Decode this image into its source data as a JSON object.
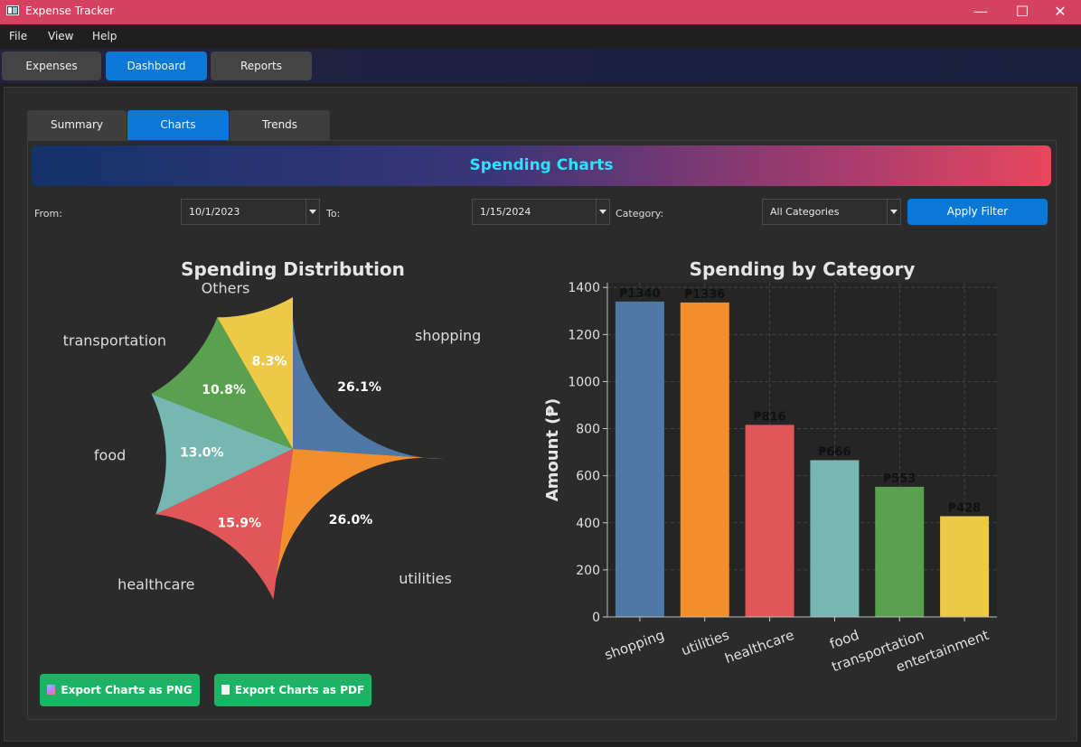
{
  "window": {
    "title": "Expense Tracker",
    "minimize_glyph": "—",
    "maximize_glyph": "☐",
    "close_glyph": "✕"
  },
  "menu": [
    "File",
    "View",
    "Help"
  ],
  "main_tabs": [
    "Expenses",
    "Dashboard",
    "Reports"
  ],
  "active_main_tab": "Dashboard",
  "sub_tabs": [
    "Summary",
    "Charts",
    "Trends"
  ],
  "active_sub_tab": "Charts",
  "banner": {
    "title": "Spending Charts"
  },
  "filters": {
    "from_label": "From:",
    "from_value": "10/1/2023",
    "to_label": "To:",
    "to_value": "1/15/2024",
    "category_label": "Category:",
    "category_value": "All Categories",
    "apply_label": "Apply Filter"
  },
  "export": {
    "png_label": "Export Charts as PNG",
    "pdf_label": "Export Charts as PDF",
    "png_icon": "image-icon",
    "pdf_icon": "document-icon"
  },
  "colors": {
    "accent": "#0a78d4",
    "titlebar": "#d4425f",
    "export": "#1db365",
    "banner_text": "#2be3ff"
  },
  "chart_data": [
    {
      "type": "pie",
      "title": "Spending Distribution",
      "labels": [
        "shopping",
        "utilities",
        "healthcare",
        "food",
        "transportation",
        "Others"
      ],
      "values": [
        26.1,
        26.0,
        15.9,
        13.0,
        10.8,
        8.3
      ],
      "value_labels": [
        "26.1%",
        "26.0%",
        "15.9%",
        "13.0%",
        "10.8%",
        "8.3%"
      ],
      "colors": [
        "#4e79a7",
        "#f28e2b",
        "#e15759",
        "#76b7b2",
        "#59a14f",
        "#edc948"
      ],
      "start_angle": "top, clockwise"
    },
    {
      "type": "bar",
      "title": "Spending by Category",
      "ylabel": "Amount (₱)",
      "categories": [
        "shopping",
        "utilities",
        "healthcare",
        "food",
        "transportation",
        "entertainment"
      ],
      "values": [
        1340,
        1336,
        816,
        666,
        553,
        428
      ],
      "value_labels": [
        "₱1340",
        "₱1336",
        "₱816",
        "₱666",
        "₱553",
        "₱428"
      ],
      "colors": [
        "#4e79a7",
        "#f28e2b",
        "#e15759",
        "#76b7b2",
        "#59a14f",
        "#edc948"
      ],
      "ylim": [
        0,
        1420
      ],
      "yticks": [
        0,
        200,
        400,
        600,
        800,
        1000,
        1200,
        1400
      ],
      "grid": true
    }
  ]
}
